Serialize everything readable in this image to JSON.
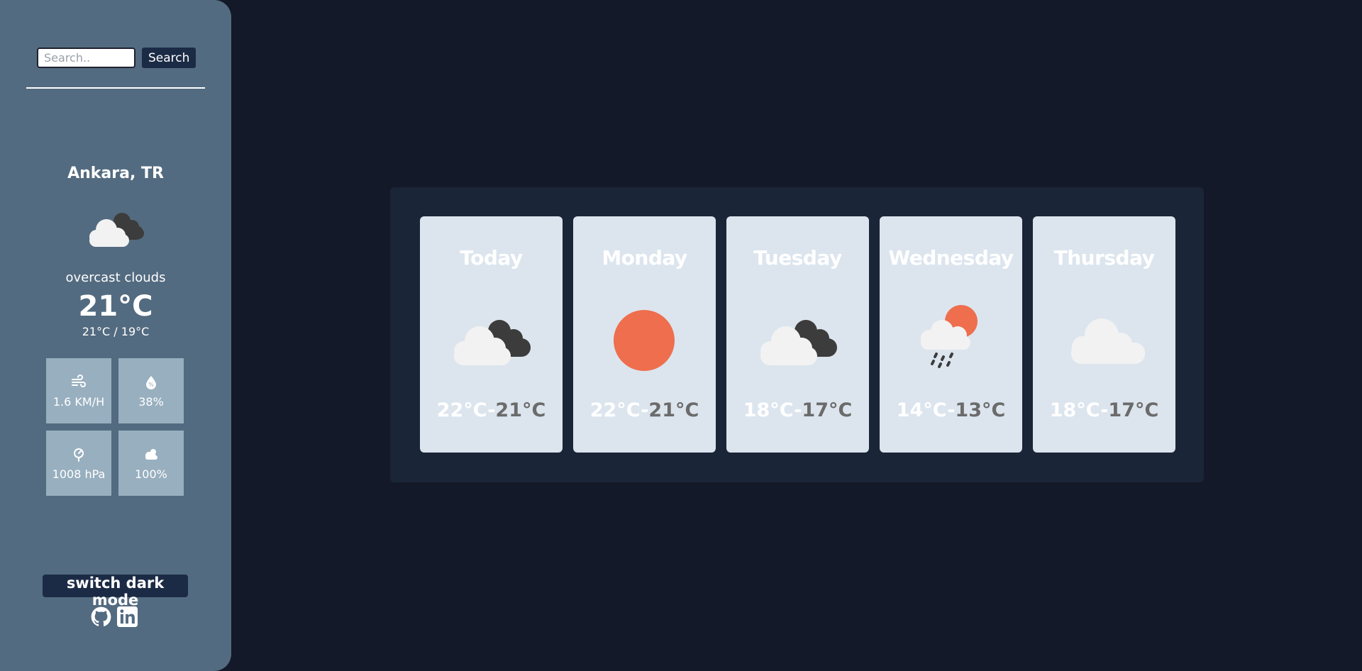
{
  "search": {
    "placeholder": "Search..",
    "button_label": "Search"
  },
  "current": {
    "city": "Ankara, TR",
    "icon": "overcast-clouds-icon",
    "description": "overcast clouds",
    "temperature": "21°C",
    "minmax": "21°C / 19°C",
    "stats": {
      "wind": "1.6 KM/H",
      "humidity": "38%",
      "pressure": "1008 hPa",
      "cloudiness": "100%"
    }
  },
  "footer": {
    "dark_mode_label": "switch dark mode",
    "links": [
      "github-icon",
      "linkedin-icon"
    ]
  },
  "forecast": [
    {
      "day": "Today",
      "icon": "overcast-clouds-icon",
      "high": "22°C",
      "low": "21°C"
    },
    {
      "day": "Monday",
      "icon": "sun-icon",
      "high": "22°C",
      "low": "21°C"
    },
    {
      "day": "Tuesday",
      "icon": "overcast-clouds-icon",
      "high": "18°C",
      "low": "17°C"
    },
    {
      "day": "Wednesday",
      "icon": "rain-sun-icon",
      "high": "14°C",
      "low": "13°C"
    },
    {
      "day": "Thursday",
      "icon": "cloud-icon",
      "high": "18°C",
      "low": "17°C"
    }
  ],
  "colors": {
    "page_bg": "#131928",
    "sidebar_bg": "#536b80",
    "panel_bg": "#1b2538",
    "card_bg": "#dce5ee",
    "button_bg": "#1c2b45",
    "stat_bg": "#98afbf",
    "sun": "#ee6e4d"
  }
}
